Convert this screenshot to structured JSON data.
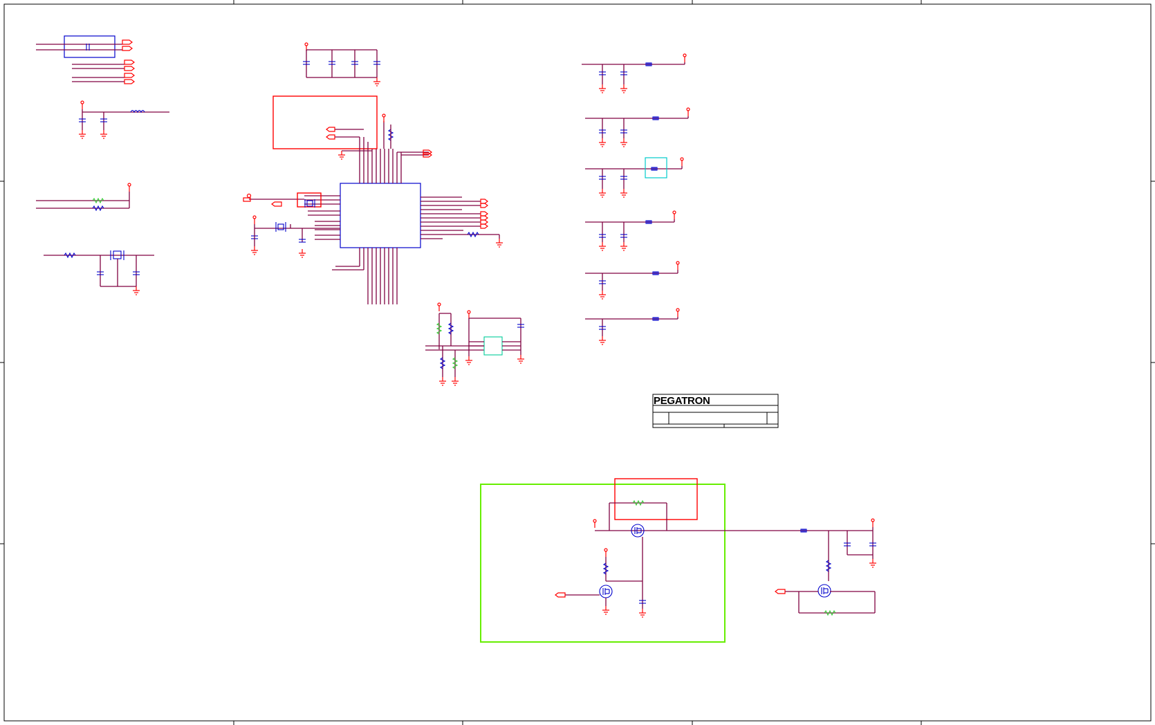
{
  "title_block": {
    "company_logo": "PEGATRON"
  },
  "colors": {
    "wire": "#800040",
    "power_and_ground": "#ff0000",
    "passive_component": "#0000cc",
    "highlight_green": "#66ee00",
    "highlight_red": "#ff0000",
    "highlight_cyan": "#00cccc"
  }
}
